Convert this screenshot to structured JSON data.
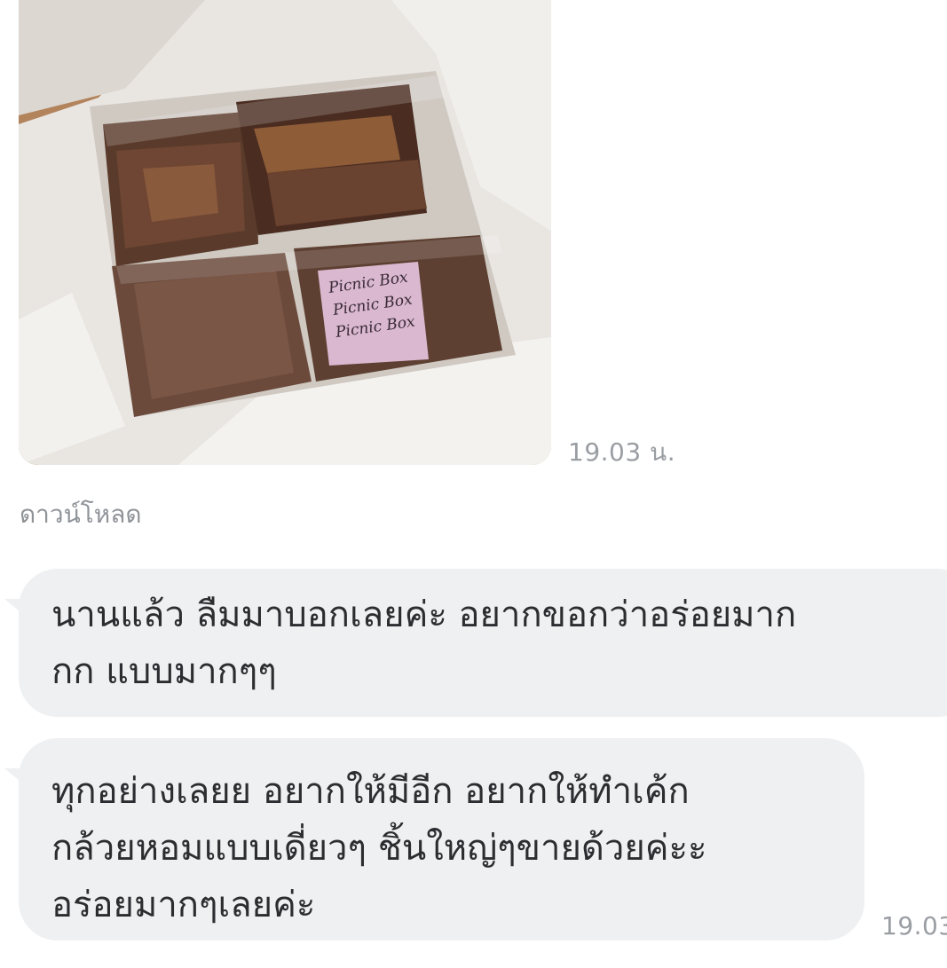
{
  "messages": [
    {
      "type": "image",
      "image_description": "box-of-wrapped-brownies",
      "label_text": "Picnic Box",
      "time": "19.03 น."
    },
    {
      "type": "action",
      "download_label": "ดาวน์โหลด"
    },
    {
      "type": "text",
      "lines": [
        "นานแล้ว ลืมมาบอกเลยค่ะ อยากขอกว่าอร่อยมาก",
        "กก แบบมากๆๆ"
      ]
    },
    {
      "type": "text",
      "lines": [
        "ทุกอย่างเลยย อยากให้มีอีก อยากให้ทำเค้ก",
        "กล้วยหอมแบบเดี่ยวๆ ชิ้นใหญ่ๆขายด้วยค่ะะ",
        "อร่อยมากๆเลยค่ะ"
      ],
      "time": "19.03"
    }
  ],
  "colors": {
    "bubble_bg": "#eff0f2",
    "text": "#2b2d30",
    "meta_text": "#9a9ea3"
  }
}
